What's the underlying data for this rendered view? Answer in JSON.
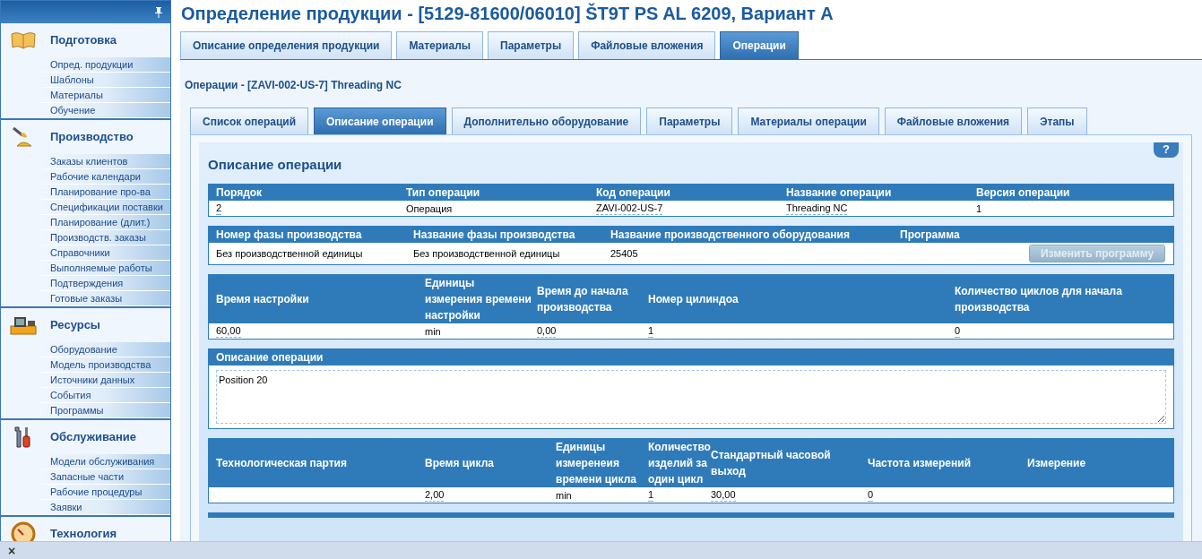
{
  "sidebar": {
    "sections": [
      {
        "title": "Подготовка",
        "items": [
          "Опред. продукции",
          "Шаблоны",
          "Материалы",
          "Обучение"
        ]
      },
      {
        "title": "Производство",
        "items": [
          "Заказы клиентов",
          "Рабочие календари",
          "Планирование про-ва",
          "Спецификации поставки",
          "Планирование (длит.)",
          "Производств. заказы",
          "Справочники",
          "Выполняемые работы",
          "Подтверждения",
          "Готовые заказы"
        ]
      },
      {
        "title": "Ресурсы",
        "items": [
          "Оборудование",
          "Модель производства",
          "Источники данных",
          "События",
          "Программы"
        ]
      },
      {
        "title": "Обслуживание",
        "items": [
          "Модели обслуживания",
          "Запасные части",
          "Рабочие процедуры",
          "Заявки"
        ]
      },
      {
        "title": "Технология"
      }
    ]
  },
  "page_title": "Определение продукции - [5129-81600/06010] ŠT9T PS AL 6209, Вариант А",
  "tabs": [
    {
      "label": "Описание определения продукции",
      "selected": false
    },
    {
      "label": "Материалы",
      "selected": false
    },
    {
      "label": "Параметры",
      "selected": false
    },
    {
      "label": "Файловые вложения",
      "selected": false
    },
    {
      "label": "Операции",
      "selected": true
    }
  ],
  "subtitle": "Операции - [ZAVI-002-US-7] Threading NC",
  "sub_tabs": [
    {
      "label": "Список операций",
      "selected": false
    },
    {
      "label": "Описание операции",
      "selected": true
    },
    {
      "label": "Дополнительно оборудование",
      "selected": false
    },
    {
      "label": "Параметры",
      "selected": false
    },
    {
      "label": "Материалы операции",
      "selected": false
    },
    {
      "label": "Файловые вложения",
      "selected": false
    },
    {
      "label": "Этапы",
      "selected": false
    }
  ],
  "panel": {
    "title": "Описание операции",
    "help": "?",
    "tables": [
      {
        "kind": "grid",
        "columns": [
          {
            "header": "Порядок",
            "value": "2",
            "editable": true
          },
          {
            "header": "Тип операции",
            "value": "Операция",
            "editable": false
          },
          {
            "header": "Код операции",
            "value": "ZAVI-002-US-7",
            "editable": true
          },
          {
            "header": "Название операции",
            "value": "Threading NC",
            "editable": true
          },
          {
            "header": "Версия операции",
            "value": "1",
            "editable": false
          }
        ]
      },
      {
        "kind": "grid",
        "columns": [
          {
            "header": "Номер фазы производства",
            "value": "Без производственной единицы",
            "editable": false
          },
          {
            "header": "Название фазы производства",
            "value": "Без производственной единицы",
            "editable": false
          },
          {
            "header": "Название производственного оборудования",
            "value": "25405",
            "editable": false
          },
          {
            "header": "Программа"
          }
        ],
        "button": {
          "label": "Изменить программу",
          "disabled": true
        }
      },
      {
        "kind": "grid",
        "columns": [
          {
            "header": "Время настройки",
            "value": "60,00",
            "editable": true
          },
          {
            "header": "Единицы измерения времени настройки",
            "value": "min",
            "editable": false
          },
          {
            "header": "Время до начала производства",
            "value": "0,00",
            "editable": true
          },
          {
            "header": "Номер цилиндоа",
            "value": "1",
            "editable": true
          },
          {
            "header": "Количество циклов для начала производства",
            "value": "0",
            "editable": true
          }
        ]
      },
      {
        "kind": "text",
        "header": "Описание операции",
        "value": "Position 20"
      },
      {
        "kind": "grid",
        "columns": [
          {
            "header": "Технологическая партия"
          },
          {
            "header": "Время цикла",
            "value": "2,00",
            "editable": true
          },
          {
            "header": "Единицы измеренеия времени цикла",
            "value": "min",
            "editable": false
          },
          {
            "header": "Количество изделий за один цикл",
            "value": "1",
            "editable": true
          },
          {
            "header": "Стандартный часовой выход",
            "value": "30,00",
            "editable": true
          },
          {
            "header": "Частота измерений",
            "value": "0",
            "editable": true
          },
          {
            "header": "Измерение"
          }
        ]
      }
    ]
  },
  "status_bar": {
    "close": "×"
  }
}
